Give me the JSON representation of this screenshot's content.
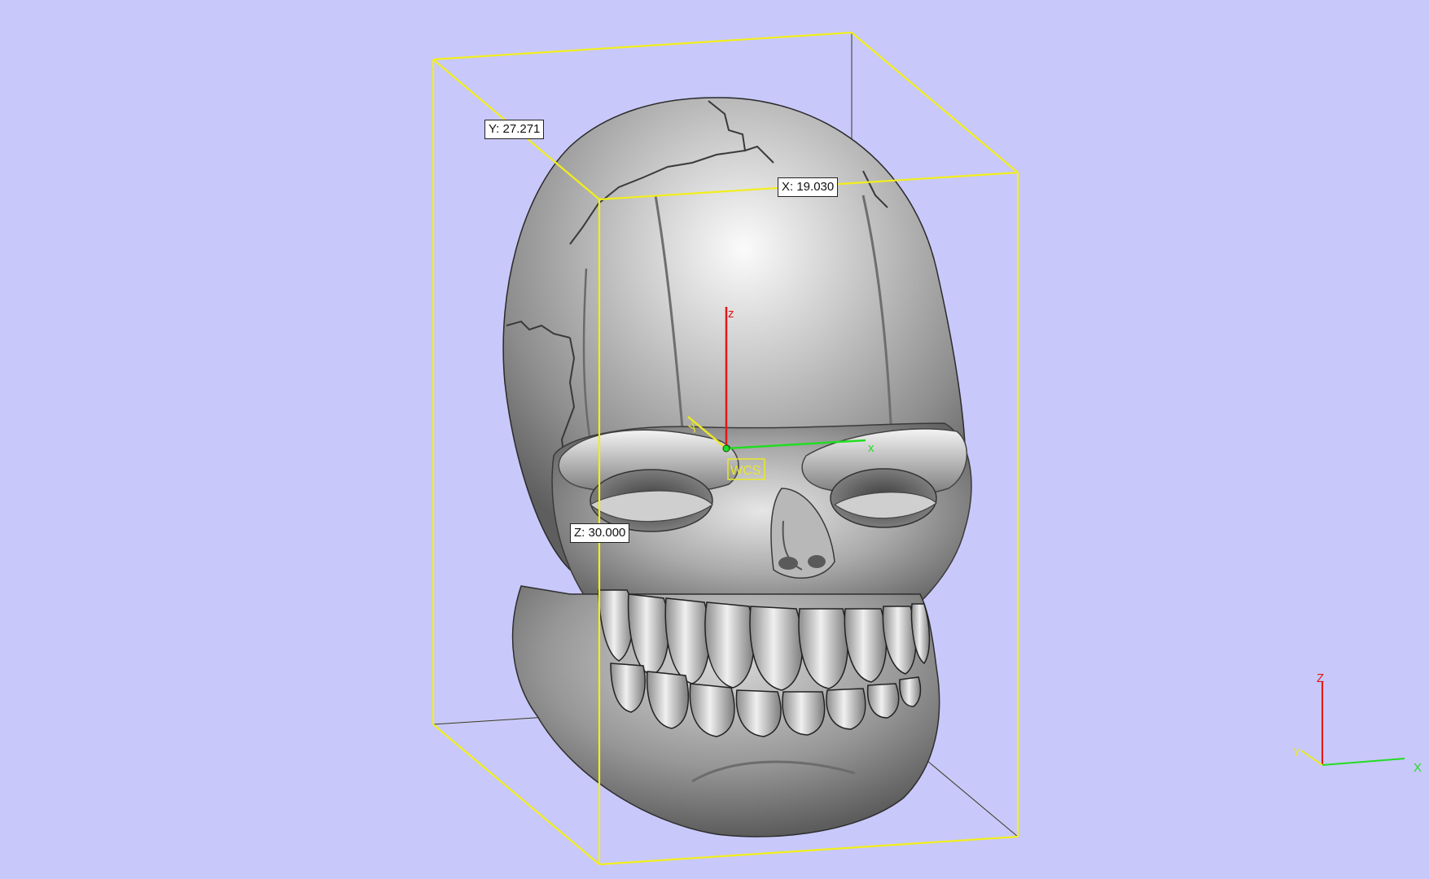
{
  "dimensions": {
    "y_label": "Y: 27.271",
    "x_label": "X: 19.030",
    "z_label": "Z: 30.000"
  },
  "wcs": {
    "label": "WCS",
    "axis_z": "z",
    "axis_x": "x",
    "axis_y": "y"
  },
  "triad": {
    "z": "Z",
    "x": "X",
    "y": "Y"
  },
  "colors": {
    "background": "#c8c8fa",
    "bounding_box": "#f2ef1a",
    "axis_z": "#e01818",
    "axis_x": "#22dd22",
    "axis_y": "#e8e82a"
  }
}
